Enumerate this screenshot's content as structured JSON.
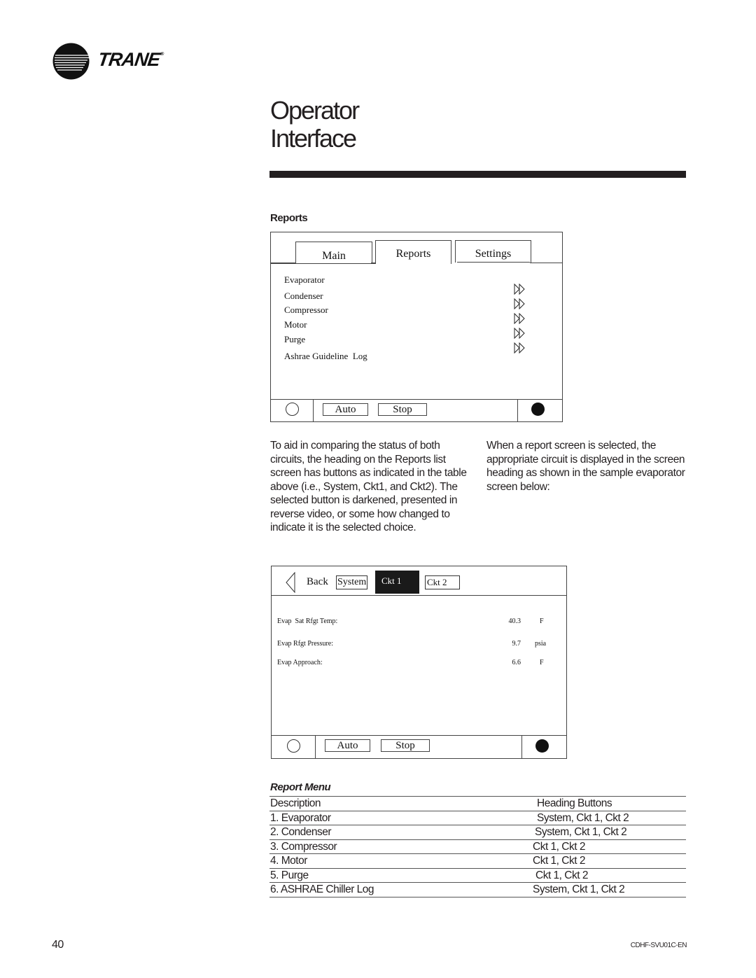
{
  "brand": {
    "name": "TRANE",
    "reg_mark": "®",
    "logo_icon": "trane-circle-logo-icon"
  },
  "page_title": {
    "line1": "Operator",
    "line2": "Interface"
  },
  "section_heading": "Reports",
  "reports_screen": {
    "tabs": [
      {
        "label": "Main",
        "selected": false
      },
      {
        "label": "Reports",
        "selected": true
      },
      {
        "label": "Settings",
        "selected": false
      }
    ],
    "items": [
      {
        "label": "Evaporator",
        "icon": "fast-forward-icon"
      },
      {
        "label": "Condenser",
        "icon": "fast-forward-icon"
      },
      {
        "label": "Compressor",
        "icon": "fast-forward-icon"
      },
      {
        "label": "Motor",
        "icon": "fast-forward-icon"
      },
      {
        "label": "Purge",
        "icon": "fast-forward-icon"
      },
      {
        "label": "Ashrae Guideline  Log"
      }
    ],
    "bottom_bar": {
      "auto_label": "Auto",
      "stop_label": "Stop"
    }
  },
  "paragraph_left": "To aid in comparing the status of both circuits, the heading on the Reports list screen has buttons as indicated in the table above (i.e., System, Ckt1, and Ckt2). The selected button is darkened, presented in reverse video, or some how changed to indicate it is the selected choice.",
  "paragraph_right": "When a report screen is selected, the appropriate circuit is displayed in the screen heading as shown in the sample evaporator screen below:",
  "evap_screen": {
    "back_label": "Back",
    "header_buttons": [
      {
        "label": "System",
        "selected": false
      },
      {
        "label": "Ckt 1",
        "selected": true
      },
      {
        "label": "Ckt 2",
        "selected": false
      }
    ],
    "rows": [
      {
        "label": "Evap  Sat Rfgt Temp:",
        "value": "40.3",
        "unit": "F"
      },
      {
        "label": "Evap Rfgt Pressure:",
        "value": "9.7",
        "unit": "psia"
      },
      {
        "label": "Evap Approach:",
        "value": "6.6",
        "unit": "F"
      }
    ],
    "bottom_bar": {
      "auto_label": "Auto",
      "stop_label": "Stop"
    }
  },
  "report_menu": {
    "title": "Report Menu",
    "headers": {
      "description": "Description",
      "buttons": "Heading Buttons"
    },
    "rows": [
      {
        "description": "1. Evaporator",
        "buttons": "System, Ckt 1, Ckt 2"
      },
      {
        "description": "2. Condenser",
        "buttons": "System, Ckt 1, Ckt 2"
      },
      {
        "description": "3. Compressor",
        "buttons": "Ckt 1, Ckt 2"
      },
      {
        "description": "4. Motor",
        "buttons": "Ckt 1, Ckt 2"
      },
      {
        "description": "5. Purge",
        "buttons": "Ckt 1, Ckt 2"
      },
      {
        "description": "6. ASHRAE Chiller Log",
        "buttons": "System, Ckt 1, Ckt 2"
      }
    ]
  },
  "footer": {
    "page_number": "40",
    "doc_code": "CDHF-SVU01C-EN"
  }
}
